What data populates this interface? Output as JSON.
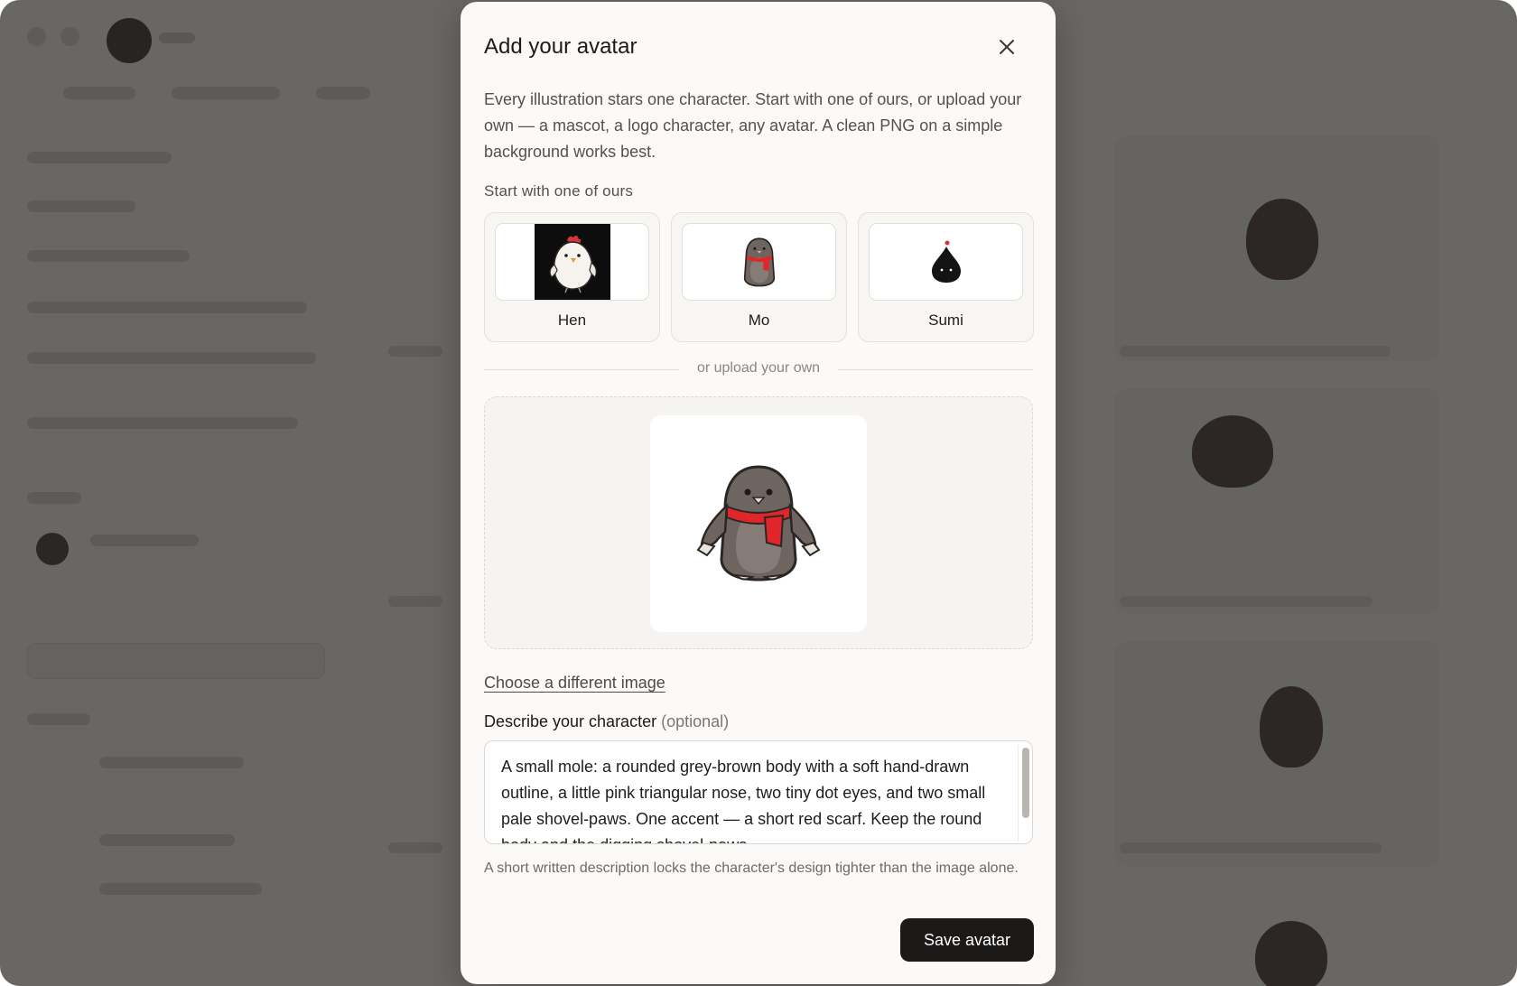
{
  "modal": {
    "title": "Add your avatar",
    "intro": "Every illustration stars one character. Start with one of ours, or upload your own — a mascot, a logo character, any avatar. A clean PNG on a simple background works best.",
    "presets_label": "Start with one of ours",
    "presets": [
      {
        "name": "Hen",
        "icon": "hen-icon"
      },
      {
        "name": "Mo",
        "icon": "mole-icon"
      },
      {
        "name": "Sumi",
        "icon": "ink-drop-icon"
      }
    ],
    "divider_text": "or upload your own",
    "preview_icon": "mole-icon",
    "choose_link": "Choose a different image",
    "describe_label": "Describe your character",
    "describe_optional": "(optional)",
    "describe_value": "A small mole: a rounded grey-brown body with a soft hand-drawn outline, a little pink triangular nose, two tiny dot eyes, and two small pale shovel-paws. One accent — a short red scarf. Keep the round body and the digging shovel-paws.",
    "hint": "A short written description locks the character's design tighter than the image alone.",
    "save_label": "Save avatar"
  },
  "colors": {
    "scrim": "#262422",
    "modal_bg": "#fbfaf8",
    "primary_button": "#1c1a19",
    "scarf_red": "#e0262b"
  }
}
